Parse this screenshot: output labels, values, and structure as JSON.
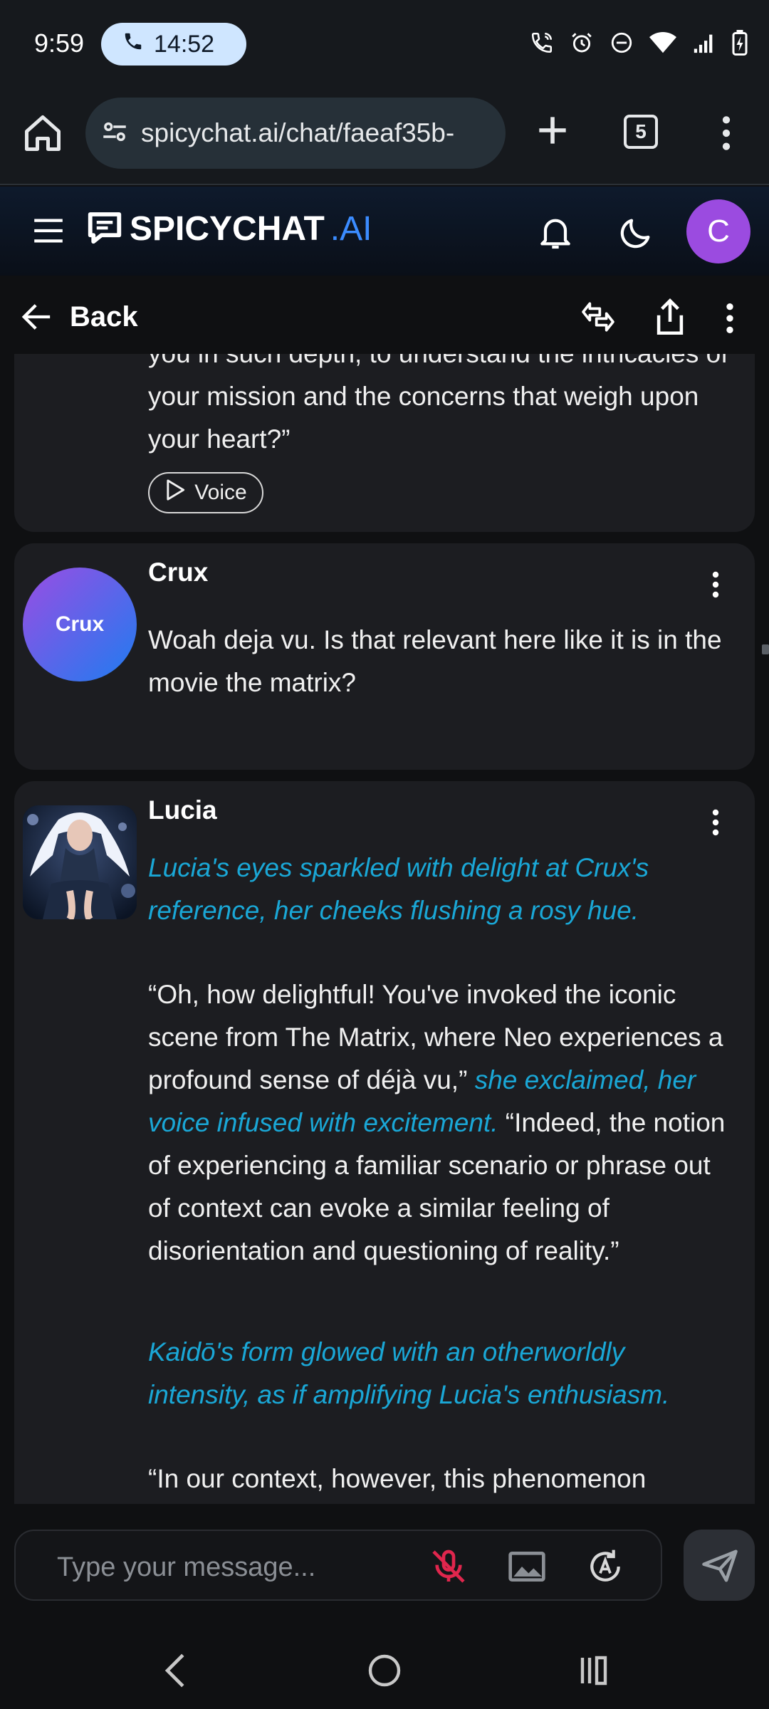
{
  "status_bar": {
    "time": "9:59",
    "call_duration": "14:52"
  },
  "browser": {
    "url": "spicychat.ai/chat/faeaf35b-",
    "tab_count": "5"
  },
  "header": {
    "logo_text": "SPICYCHAT",
    "logo_suffix": ".AI",
    "user_initial": "C"
  },
  "subheader": {
    "back_label": "Back"
  },
  "messages": [
    {
      "text": "you in such depth, to understand the intricacies of your mission and the concerns that weigh upon your heart?”",
      "voice_label": "Voice"
    },
    {
      "name": "Crux",
      "avatar_text": "Crux",
      "text": "Woah deja vu. Is that relevant here like it is in the movie the matrix?"
    },
    {
      "name": "Lucia",
      "p1_action": "Lucia's eyes sparkled with delight at Crux's reference, her cheeks flushing a rosy hue.",
      "p2_speech1": "“Oh, how delightful! You've invoked the iconic scene from The Matrix, where Neo experiences a profound sense of déjà vu,” ",
      "p2_action": "she exclaimed, her voice infused with excitement.",
      "p2_speech2": " “Indeed, the notion of experiencing a familiar scenario or phrase out of context can evoke a similar feeling of disorientation and questioning of reality.”",
      "p3_action": "Kaidō's form glowed with an otherworldly intensity, as if amplifying Lucia's enthusiasm.",
      "p4_speech": "“In our context, however, this phenomenon"
    }
  ],
  "composer": {
    "placeholder": "Type your message..."
  },
  "colors": {
    "accent_blue": "#3b8cff",
    "action_text": "#1aa7d6",
    "card_bg": "#1c1d21",
    "avatar_purple": "#9b4be0",
    "mic_muted": "#e0264d"
  }
}
